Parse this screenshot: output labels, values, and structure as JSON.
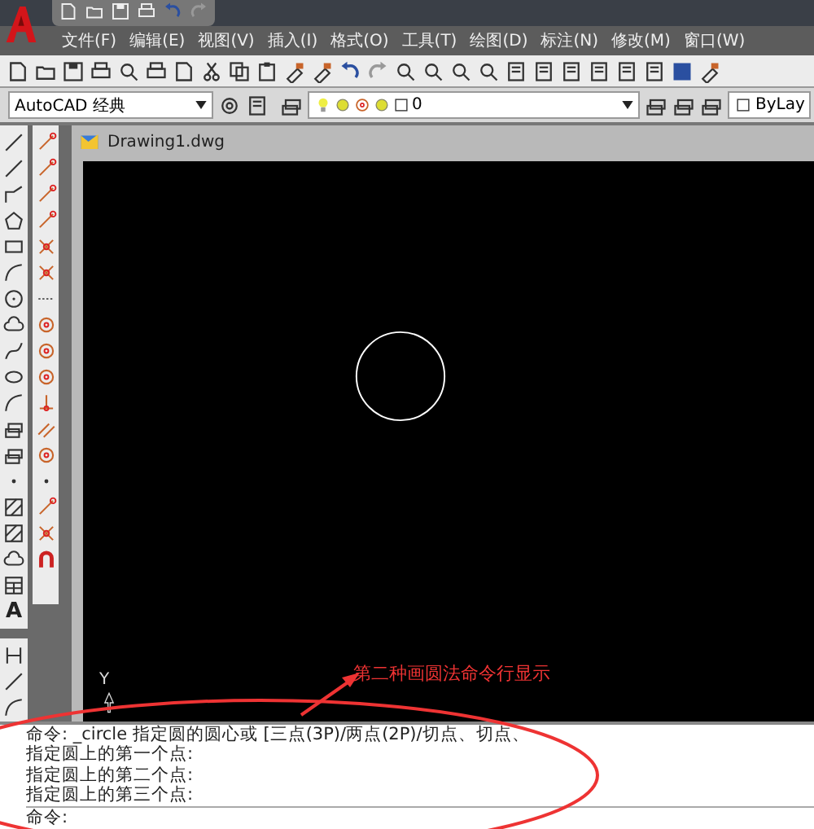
{
  "menu": [
    {
      "label": "文件(F)"
    },
    {
      "label": "编辑(E)"
    },
    {
      "label": "视图(V)"
    },
    {
      "label": "插入(I)"
    },
    {
      "label": "格式(O)"
    },
    {
      "label": "工具(T)"
    },
    {
      "label": "绘图(D)"
    },
    {
      "label": "标注(N)"
    },
    {
      "label": "修改(M)"
    },
    {
      "label": "窗口(W)"
    }
  ],
  "workspace": {
    "value": "AutoCAD 经典"
  },
  "layer": {
    "value": "0"
  },
  "color_control": {
    "value": "ByLay"
  },
  "draw_toolbar": {
    "text_tool": "A"
  },
  "drawing_tab": {
    "title": "Drawing1.dwg"
  },
  "ucs": {
    "axis_label": "Y"
  },
  "annotation": {
    "text": "第二种画圆法命令行显示"
  },
  "command_lines": [
    "命令:  _circle 指定圆的圆心或 [三点(3P)/两点(2P)/切点、切点、",
    "指定圆上的第一个点:",
    "指定圆上的第二个点:",
    "指定圆上的第三个点:",
    "命令:"
  ]
}
